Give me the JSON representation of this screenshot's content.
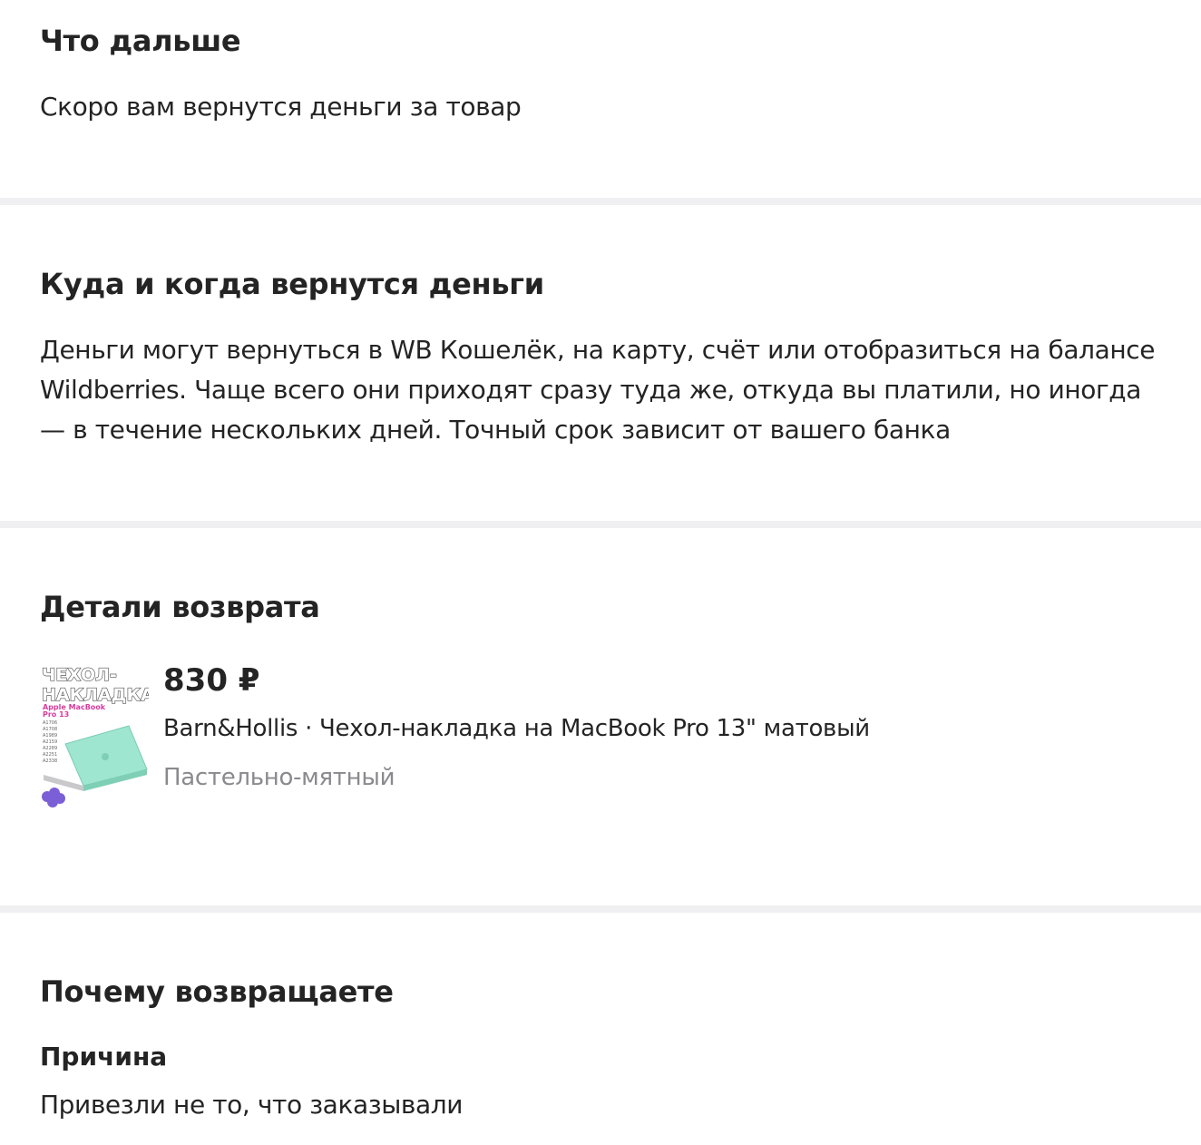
{
  "next_section": {
    "title": "Что дальше",
    "text": "Скоро вам вернутся деньги за товар"
  },
  "money_section": {
    "title": "Куда и когда вернутся деньги",
    "text": "Деньги могут вернуться в WB Кошелёк, на карту, счёт или отобразиться на балансе Wildberries. Чаще всего они приходят сразу туда же, откуда вы платили, но иногда — в течение нескольких дней. Точный срок зависит от вашего банка"
  },
  "details_section": {
    "title": "Детали возврата",
    "product": {
      "price": "830 ₽",
      "name": "Barn&Hollis · Чехол-накладка на MacBook Pro 13\" матовый",
      "color": "Пастельно-мятный",
      "image_caption_line1": "ЧЕХОЛ-",
      "image_caption_line2": "НАКЛАДКА",
      "image_caption_sub1": "Apple MacBook",
      "image_caption_sub2": "Pro 13",
      "image_models": [
        "A1706",
        "A1708",
        "A1989",
        "A2159",
        "A2289",
        "A2251",
        "A2338"
      ],
      "image_color": "#9ee6cf"
    }
  },
  "reason_section": {
    "title": "Почему возвращаете",
    "reason_label": "Причина",
    "reason_value": "Привезли не то, что заказывали"
  },
  "colors": {
    "divider": "#f0f0f2",
    "text": "#242424",
    "muted": "#8a8a8e"
  }
}
